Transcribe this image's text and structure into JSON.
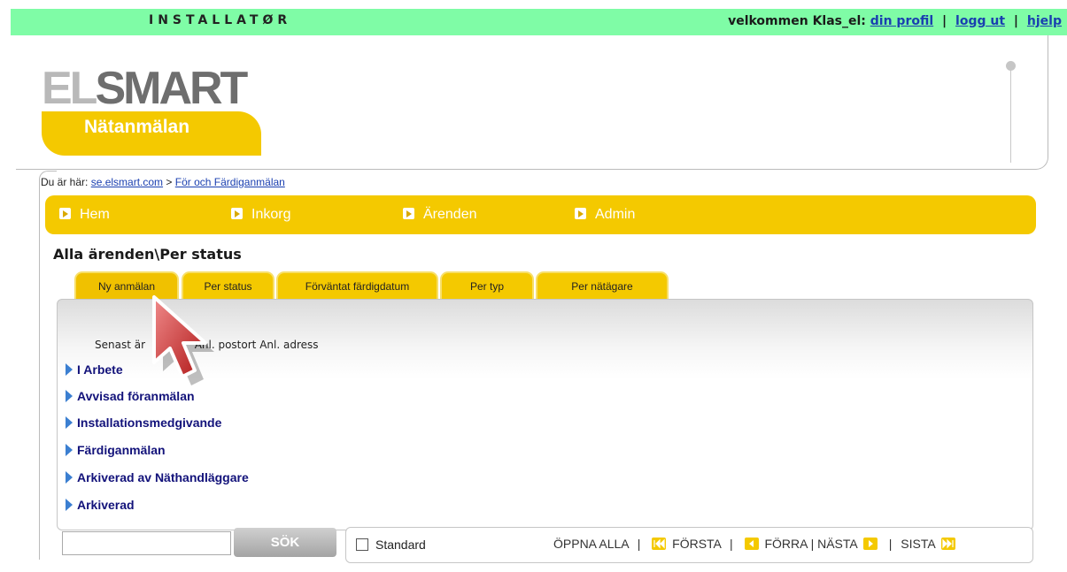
{
  "topbar": {
    "role": "INSTALLATØR",
    "welcome_prefix": "velkommen Klas_el:",
    "profile_link": "din profil",
    "logout_link": "logg ut",
    "help_link": "hjelp",
    "separator": "|"
  },
  "logo": {
    "part1": "EL",
    "part2": "SMART",
    "subtitle": "Nätanmälan"
  },
  "breadcrumb": {
    "prefix": "Du är här:",
    "home": "se.elsmart.com",
    "arrow": ">",
    "current": "För och Färdiganmälan"
  },
  "nav": {
    "items": [
      {
        "label": "Hem"
      },
      {
        "label": "Inkorg"
      },
      {
        "label": "Ärenden"
      },
      {
        "label": "Admin"
      }
    ]
  },
  "page_title": "Alla ärenden\\Per status",
  "tabs": [
    {
      "label": "Ny anmälan",
      "active": true
    },
    {
      "label": "Per status"
    },
    {
      "label": "Förväntat färdigdatum"
    },
    {
      "label": "Per typ"
    },
    {
      "label": "Per nätägare"
    }
  ],
  "columns": {
    "senast": "Senast är",
    "postort": "Anl. postort",
    "adress": "Anl. adress"
  },
  "status_groups": [
    "I Arbete",
    "Avvisad föranmälan",
    "Installationsmedgivande",
    "Färdiganmälan",
    "Arkiverad av Näthandläggare",
    "Arkiverad"
  ],
  "search": {
    "value": "",
    "button": "SÖK"
  },
  "pager": {
    "standard_label": "Standard",
    "open_all": "ÖPPNA ALLA",
    "first": "FÖRSTA",
    "prev": "FÖRRA",
    "next": "NÄSTA",
    "last": "SISTA",
    "separator": "|"
  },
  "colors": {
    "topbar": "#7ffca6",
    "accent_yellow": "#f4c900",
    "link_blue": "#1a3fb0",
    "status_blue": "#12127a"
  }
}
